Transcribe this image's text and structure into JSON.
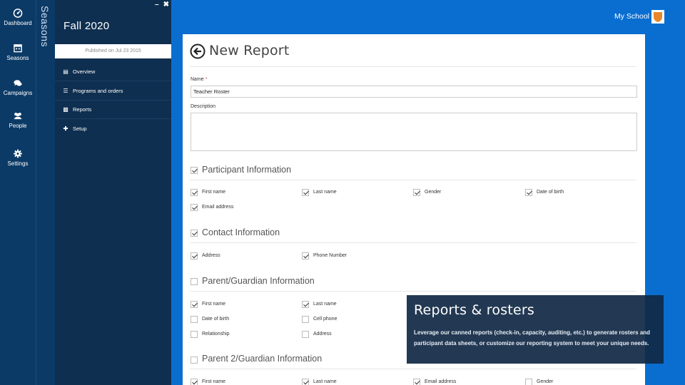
{
  "rail": [
    {
      "label": "Dashboard",
      "icon": "dashboard-icon"
    },
    {
      "label": "Seasons",
      "icon": "calendar-icon"
    },
    {
      "label": "Campaigns",
      "icon": "chat-icon"
    },
    {
      "label": "People",
      "icon": "people-icon"
    },
    {
      "label": "Settings",
      "icon": "gear-icon"
    }
  ],
  "seasons_label": "Seasons",
  "panel": {
    "season_title": "Fall 2020",
    "published": "Published on Jul 23 2015",
    "nav": [
      {
        "label": "Overview",
        "icon": "overview-icon"
      },
      {
        "label": "Programs and orders",
        "icon": "list-icon"
      },
      {
        "label": "Reports",
        "icon": "reports-icon"
      },
      {
        "label": "Setup",
        "icon": "plus-icon"
      }
    ]
  },
  "header": {
    "school": "My School",
    "brand_color": "#e8862a"
  },
  "form": {
    "title": "New Report",
    "name_label": "Name",
    "name_required": "*",
    "name_value": "Teacher Roster",
    "description_label": "Description",
    "description_value": ""
  },
  "sections": [
    {
      "title": "Participant Information",
      "checked": true,
      "fields": [
        {
          "label": "First name",
          "checked": true
        },
        {
          "label": "Last name",
          "checked": true
        },
        {
          "label": "Gender",
          "checked": true
        },
        {
          "label": "Date of birth",
          "checked": true
        },
        {
          "label": "Email address",
          "checked": true
        }
      ]
    },
    {
      "title": "Contact Information",
      "checked": true,
      "fields": [
        {
          "label": "Address",
          "checked": true
        },
        {
          "label": "Phone Number",
          "checked": true
        }
      ]
    },
    {
      "title": "Parent/Guardian Information",
      "checked": false,
      "fields": [
        {
          "label": "First name",
          "checked": true
        },
        {
          "label": "Last name",
          "checked": true
        },
        {
          "label": "Date of birth",
          "checked": false
        },
        {
          "label": "Cell phone",
          "checked": false
        },
        {
          "label": "Relationship",
          "checked": false
        },
        {
          "label": "Address",
          "checked": false
        }
      ]
    },
    {
      "title": "Parent 2/Guardian Information",
      "checked": false,
      "fields": [
        {
          "label": "First name",
          "checked": true
        },
        {
          "label": "Last name",
          "checked": true
        },
        {
          "label": "Email address",
          "checked": true
        },
        {
          "label": "Gender",
          "checked": false
        }
      ]
    }
  ],
  "overlay": {
    "title": "Reports & rosters",
    "body": "Leverage our canned reports (check-in, capacity, auditing, etc.) to generate rosters and participant data sheets, or customize our reporting system to meet your unique needs."
  }
}
